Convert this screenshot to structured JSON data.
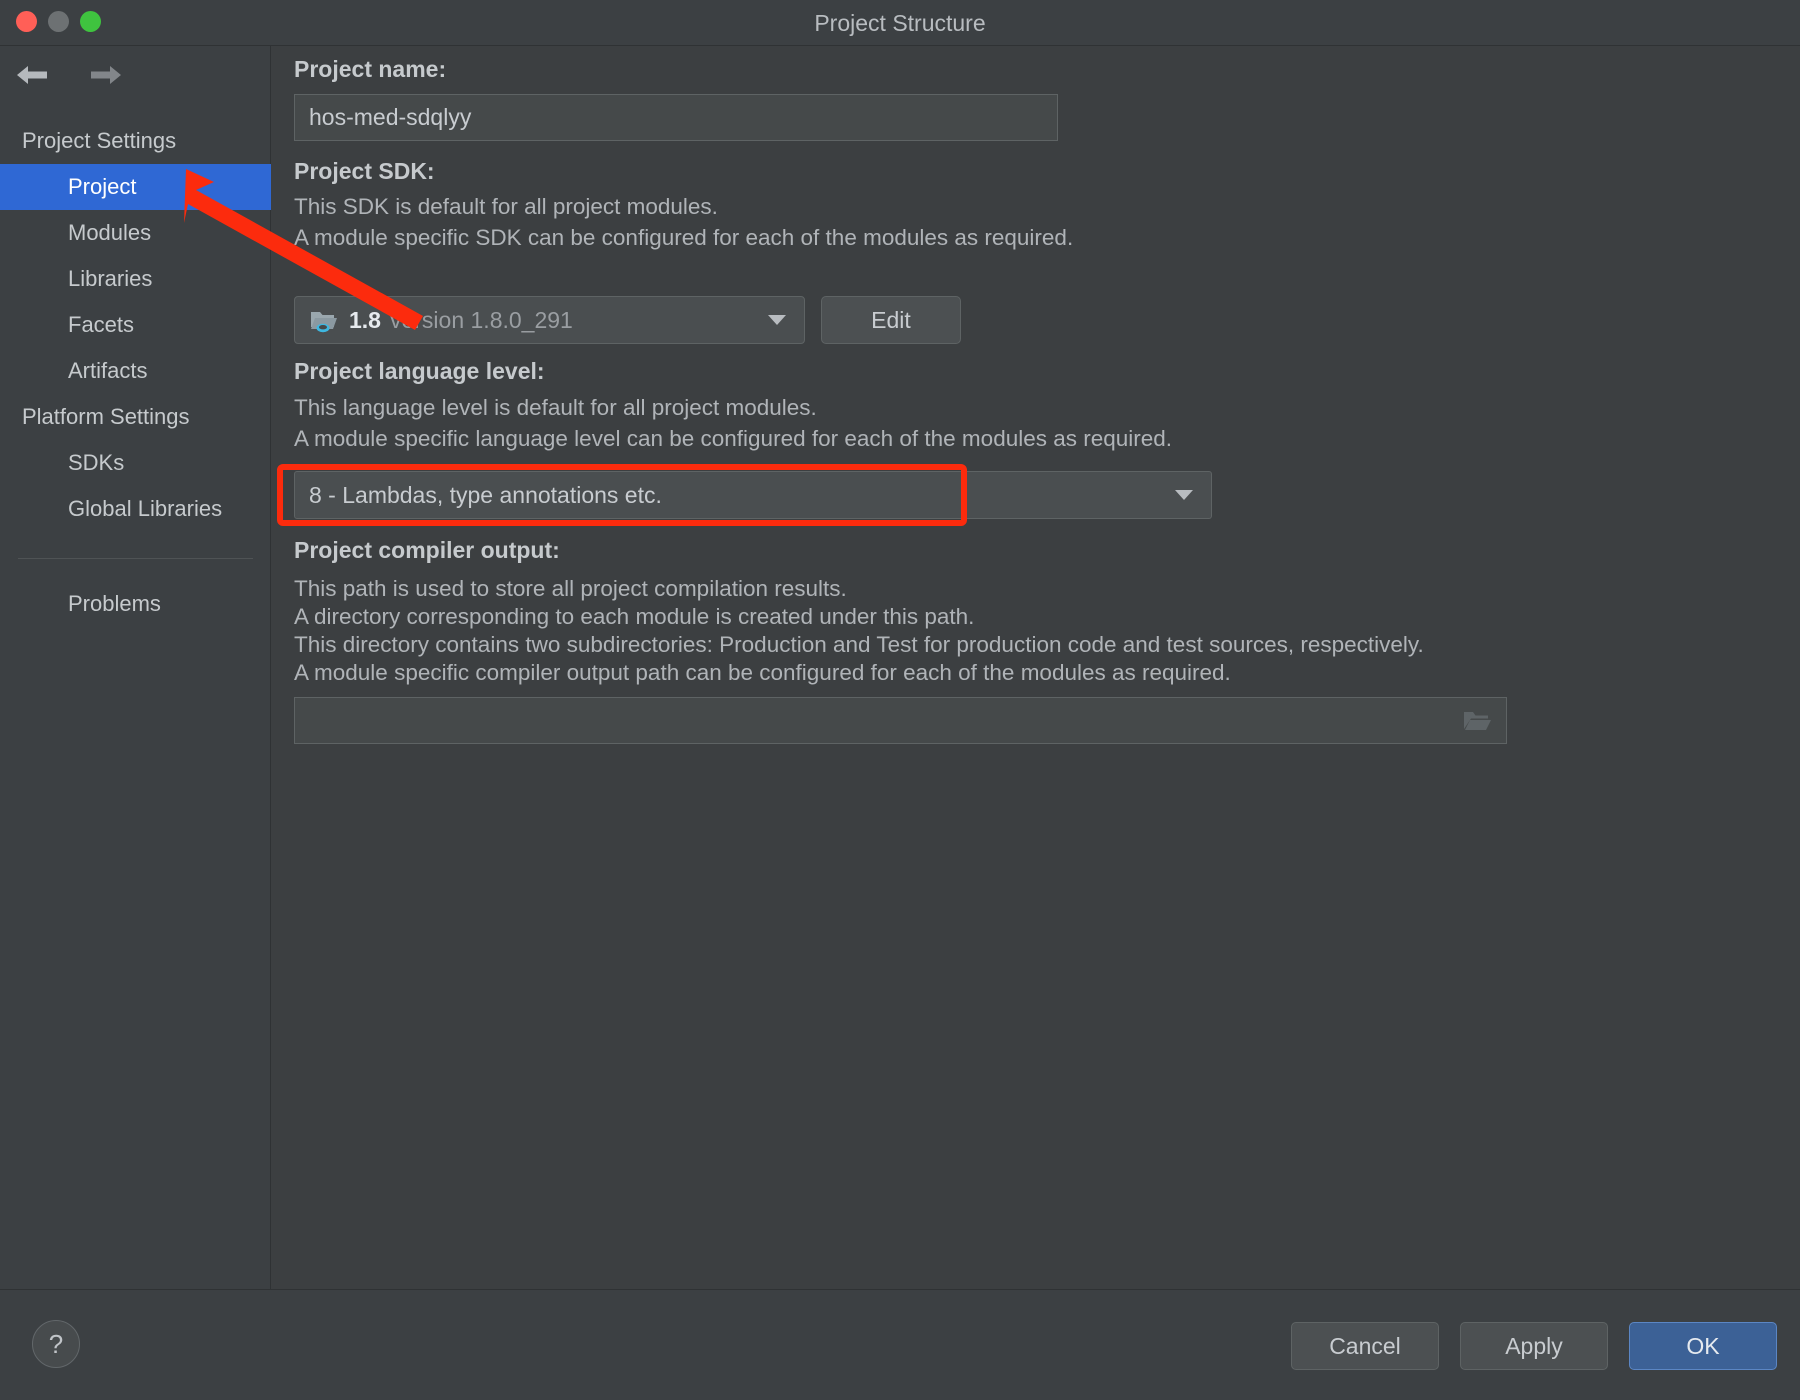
{
  "window": {
    "title": "Project Structure",
    "traffic_lights": [
      "close",
      "minimize",
      "zoom"
    ]
  },
  "nav": {
    "back_icon": "arrow-left-icon",
    "forward_icon": "arrow-right-icon"
  },
  "sidebar": {
    "groups": [
      {
        "label": "Project Settings",
        "items": [
          {
            "label": "Project",
            "selected": true
          },
          {
            "label": "Modules",
            "selected": false
          },
          {
            "label": "Libraries",
            "selected": false
          },
          {
            "label": "Facets",
            "selected": false
          },
          {
            "label": "Artifacts",
            "selected": false
          }
        ]
      },
      {
        "label": "Platform Settings",
        "items": [
          {
            "label": "SDKs",
            "selected": false
          },
          {
            "label": "Global Libraries",
            "selected": false
          }
        ]
      }
    ],
    "footer_items": [
      {
        "label": "Problems",
        "selected": false
      }
    ]
  },
  "main": {
    "project_name": {
      "label": "Project name:",
      "value": "hos-med-sdqlyy"
    },
    "project_sdk": {
      "label": "Project SDK:",
      "desc_line1": "This SDK is default for all project modules.",
      "desc_line2": "A module specific SDK can be configured for each of the modules as required.",
      "selected_name": "1.8",
      "selected_version": "version 1.8.0_291",
      "icon": "jdk-folder-icon",
      "edit_button": "Edit"
    },
    "language_level": {
      "label": "Project language level:",
      "desc_line1": "This language level is default for all project modules.",
      "desc_line2": "A module specific language level can be configured for each of the modules as required.",
      "value": "8 - Lambdas, type annotations etc."
    },
    "compiler_output": {
      "label": "Project compiler output:",
      "desc_line1": "This path is used to store all project compilation results.",
      "desc_line2": "A directory corresponding to each module is created under this path.",
      "desc_line3": "This directory contains two subdirectories: Production and Test for production code and test sources, respectively.",
      "desc_line4": "A module specific compiler output path can be configured for each of the modules as required.",
      "value": "",
      "browse_icon": "folder-browse-icon"
    }
  },
  "footer": {
    "help_label": "?",
    "cancel_label": "Cancel",
    "apply_label": "Apply",
    "ok_label": "OK"
  },
  "annotations": {
    "arrow_color": "#fc2b0d",
    "highlight_color": "#fc2b0d",
    "arrow_points_to": "sidebar-item-project",
    "highlight_target": "language-level-combo"
  },
  "colors": {
    "selection_blue": "#2f68d4",
    "primary_button": "#3c6196",
    "window_bg": "#3c3f41",
    "sidebar_bg": "#3c4043",
    "annotation_red": "#fc2b0d"
  }
}
